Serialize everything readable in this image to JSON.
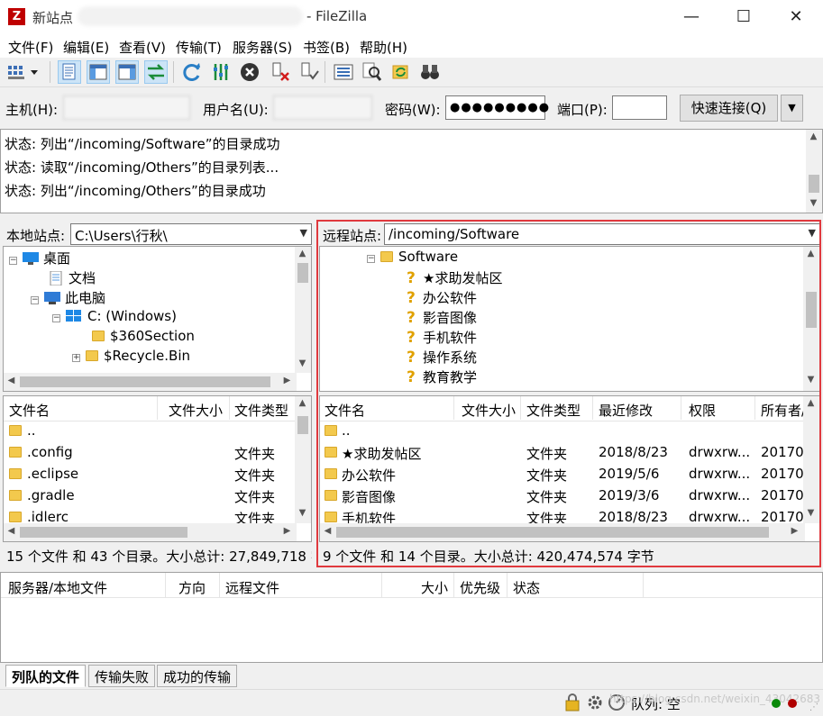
{
  "window": {
    "title_prefix": "新站点",
    "title_suffix": "- FileZilla",
    "icon_letter": "Z",
    "controls": [
      "—",
      "☐",
      "✕"
    ]
  },
  "menu": [
    "文件(F)",
    "编辑(E)",
    "查看(V)",
    "传输(T)",
    "服务器(S)",
    "书签(B)",
    "帮助(H)"
  ],
  "quickconnect": {
    "host_label": "主机(H):",
    "host_value": "",
    "user_label": "用户名(U):",
    "user_value": "",
    "pass_label": "密码(W):",
    "pass_value": "●●●●●●●●●",
    "port_label": "端口(P):",
    "port_value": "",
    "connect_label": "快速连接(Q)",
    "dropdown": "▼"
  },
  "log": [
    "状态:  列出“/incoming/Software”的目录成功",
    "状态:  读取“/incoming/Others”的目录列表...",
    "状态:  列出“/incoming/Others”的目录成功"
  ],
  "local": {
    "site_label": "本地站点:",
    "path": "C:\\Users\\行秋\\",
    "tree": [
      "桌面",
      "文档",
      "此电脑",
      "C: (Windows)",
      "$360Section",
      "$Recycle.Bin"
    ],
    "headers": [
      "文件名",
      "文件大小",
      "文件类型"
    ],
    "files": [
      {
        "name": "..",
        "size": "",
        "type": ""
      },
      {
        "name": ".config",
        "size": "",
        "type": "文件夹"
      },
      {
        "name": ".eclipse",
        "size": "",
        "type": "文件夹"
      },
      {
        "name": ".gradle",
        "size": "",
        "type": "文件夹"
      },
      {
        "name": ".idlerc",
        "size": "",
        "type": "文件夹"
      }
    ],
    "summary": "15 个文件 和 43 个目录。大小总计: 27,849,718 字节"
  },
  "remote": {
    "site_label": "远程站点:",
    "path": "/incoming/Software",
    "tree": [
      "Software",
      "★求助发帖区",
      "办公软件",
      "影音图像",
      "手机软件",
      "操作系统",
      "教育教学"
    ],
    "headers": [
      "文件名",
      "文件大小",
      "文件类型",
      "最近修改",
      "权限",
      "所有者/组"
    ],
    "files": [
      {
        "name": "..",
        "size": "",
        "type": "",
        "modified": "",
        "perm": "",
        "owner": ""
      },
      {
        "name": "★求助发帖区",
        "size": "",
        "type": "文件夹",
        "modified": "2018/8/23",
        "perm": "drwxrw...",
        "owner": "20170"
      },
      {
        "name": "办公软件",
        "size": "",
        "type": "文件夹",
        "modified": "2019/5/6",
        "perm": "drwxrw...",
        "owner": "20170"
      },
      {
        "name": "影音图像",
        "size": "",
        "type": "文件夹",
        "modified": "2019/3/6",
        "perm": "drwxrw...",
        "owner": "20170"
      },
      {
        "name": "手机软件",
        "size": "",
        "type": "文件夹",
        "modified": "2018/8/23",
        "perm": "drwxrw...",
        "owner": "20170"
      }
    ],
    "summary": "9 个文件 和 14 个目录。大小总计: 420,474,574 字节",
    "highlight_color": "#e0393e"
  },
  "queue": {
    "headers": [
      "服务器/本地文件",
      "方向",
      "远程文件",
      "大小",
      "优先级",
      "状态"
    ],
    "tabs": [
      "列队的文件",
      "传输失败",
      "成功的传输"
    ]
  },
  "statusbar": {
    "queue_text": "队列: 空",
    "watermark": "https://blog.csdn.net/weixin_43042683"
  }
}
